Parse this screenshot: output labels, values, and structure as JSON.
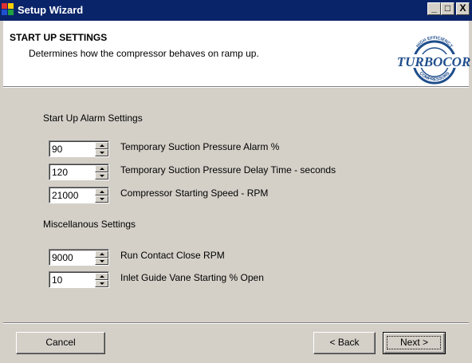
{
  "window": {
    "title": "Setup Wizard",
    "controls": {
      "minimize": "_",
      "maximize": "□",
      "close": "X"
    }
  },
  "header": {
    "title": "START UP SETTINGS",
    "subtitle": "Determines how the compressor behaves on ramp up.",
    "logo": {
      "text": "TURBOCOR",
      "ring_top": "HIGH EFFICIENCY",
      "ring_bottom": "COMPRESSORS"
    }
  },
  "sections": {
    "startup_alarm": {
      "label": "Start Up Alarm Settings",
      "fields": [
        {
          "value": "90",
          "label": "Temporary Suction Pressure Alarm %"
        },
        {
          "value": "120",
          "label": "Temporary Suction Pressure Delay Time - seconds"
        },
        {
          "value": "21000",
          "label": "Compressor Starting Speed - RPM"
        }
      ]
    },
    "misc": {
      "label": "Miscellanous Settings",
      "fields": [
        {
          "value": "9000",
          "label": "Run Contact Close RPM"
        },
        {
          "value": "10",
          "label": "Inlet Guide Vane Starting % Open"
        }
      ]
    }
  },
  "buttons": {
    "cancel": "Cancel",
    "back": "< Back",
    "next": "Next >"
  },
  "colors": {
    "titlebar": "#0a246a",
    "face": "#d4d0c8",
    "logo": "#1f4e8c"
  }
}
